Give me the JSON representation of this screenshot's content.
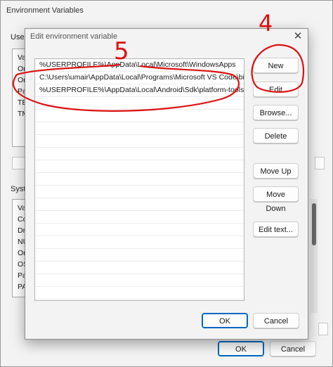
{
  "background_window": {
    "title": "Environment Variables",
    "user_group_label": "User",
    "user_list_items": [
      "Va",
      "On",
      "On",
      "Pa",
      "TE",
      "TM"
    ],
    "system_group_label": "Syste",
    "system_list_items": [
      "Va",
      "Co",
      "Dr",
      "NU",
      "Or",
      "OS",
      "Pa",
      "PA"
    ],
    "ok_label": "OK",
    "cancel_label": "Cancel"
  },
  "dialog": {
    "title": "Edit environment variable",
    "close_glyph": "✕",
    "paths": [
      "%USERPROFILE%\\AppData\\Local\\Microsoft\\WindowsApps",
      "C:\\Users\\umair\\AppData\\Local\\Programs\\Microsoft VS Code\\bin",
      "%USERPROFILE%\\AppData\\Local\\Android\\Sdk\\platform-tools"
    ],
    "buttons": {
      "new": "New",
      "edit": "Edit",
      "browse": "Browse...",
      "delete": "Delete",
      "move_up": "Move Up",
      "move_down": "Move Down",
      "edit_text": "Edit text...",
      "ok": "OK",
      "cancel": "Cancel"
    }
  },
  "annotations": {
    "label_4": "4",
    "label_5": "5",
    "color": "#dd1111"
  }
}
